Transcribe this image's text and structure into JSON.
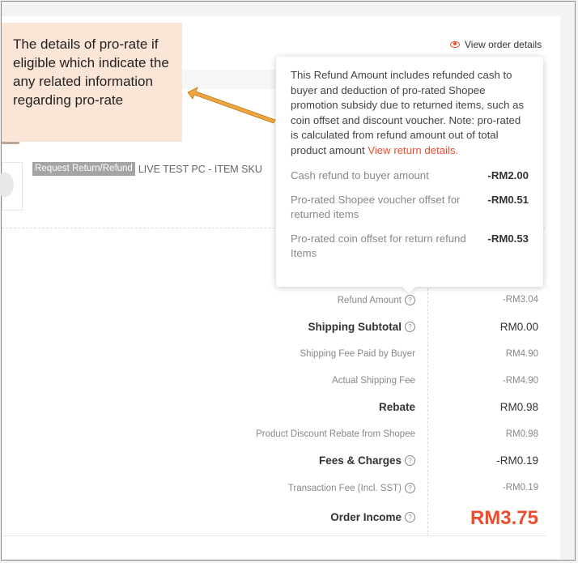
{
  "header": {
    "view_order_details": "View order details"
  },
  "product": {
    "tag": "Request Return/Refund",
    "name": "LIVE TEST PC - ITEM SKU"
  },
  "annotation": {
    "text": "The details of pro-rate if eligible which indicate the any related information regarding pro-rate"
  },
  "tooltip": {
    "text": "This Refund Amount includes refunded cash to buyer and deduction of pro-rated Shopee promotion subsidy due to returned items, such as coin offset and discount voucher. Note: pro-rated is calculated from refund amount out of total product amount",
    "link": "View return details.",
    "rows": [
      {
        "label": "Cash refund to buyer amount",
        "value": "-RM2.00"
      },
      {
        "label": "Pro-rated Shopee voucher offset for returned items",
        "value": "-RM0.51"
      },
      {
        "label": "Pro-rated coin offset for return refund Items",
        "value": "-RM0.53"
      }
    ]
  },
  "summary": {
    "refund_amount": {
      "label": "Refund Amount",
      "value": "-RM3.04"
    },
    "shipping_subtotal": {
      "label": "Shipping Subtotal",
      "value": "RM0.00"
    },
    "shipping_fee_buyer": {
      "label": "Shipping Fee Paid by Buyer",
      "value": "RM4.90"
    },
    "actual_shipping_fee": {
      "label": "Actual Shipping Fee",
      "value": "-RM4.90"
    },
    "rebate": {
      "label": "Rebate",
      "value": "RM0.98"
    },
    "product_discount_rebate": {
      "label": "Product Discount Rebate from Shopee",
      "value": "RM0.98"
    },
    "fees_charges": {
      "label": "Fees & Charges",
      "value": "-RM0.19"
    },
    "transaction_fee": {
      "label": "Transaction Fee (Incl. SST)",
      "value": "-RM0.19"
    },
    "order_income": {
      "label": "Order Income",
      "value": "RM3.75"
    }
  },
  "colors": {
    "accent": "#ee4d2d",
    "callout_bg": "#fbe5d6",
    "arrow": "#e8930c"
  }
}
